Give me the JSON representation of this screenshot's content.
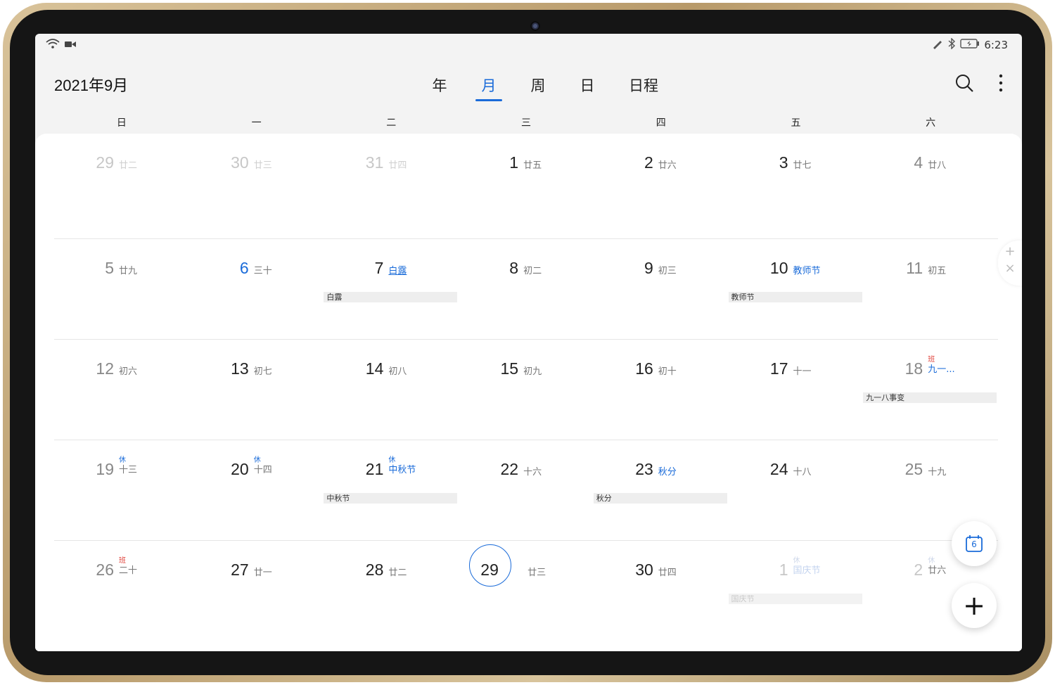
{
  "status": {
    "time": "6:23"
  },
  "header": {
    "title": "2021年9月",
    "tabs": [
      {
        "label": "年"
      },
      {
        "label": "月"
      },
      {
        "label": "周"
      },
      {
        "label": "日"
      },
      {
        "label": "日程"
      }
    ],
    "active_tab": "月"
  },
  "weekdays": [
    "日",
    "一",
    "二",
    "三",
    "四",
    "五",
    "六"
  ],
  "weeks": [
    [
      {
        "day": "29",
        "lunar": "廿二"
      },
      {
        "day": "30",
        "lunar": "廿三"
      },
      {
        "day": "31",
        "lunar": "廿四"
      },
      {
        "day": "1",
        "lunar": "廿五"
      },
      {
        "day": "2",
        "lunar": "廿六"
      },
      {
        "day": "3",
        "lunar": "廿七"
      },
      {
        "day": "4",
        "lunar": "廿八"
      }
    ],
    [
      {
        "day": "5",
        "lunar": "廿九"
      },
      {
        "day": "6",
        "lunar": "三十"
      },
      {
        "day": "7",
        "lunar": "白露",
        "event": "白露"
      },
      {
        "day": "8",
        "lunar": "初二"
      },
      {
        "day": "9",
        "lunar": "初三"
      },
      {
        "day": "10",
        "lunar": "教师节",
        "event": "教师节"
      },
      {
        "day": "11",
        "lunar": "初五"
      }
    ],
    [
      {
        "day": "12",
        "lunar": "初六"
      },
      {
        "day": "13",
        "lunar": "初七"
      },
      {
        "day": "14",
        "lunar": "初八"
      },
      {
        "day": "15",
        "lunar": "初九"
      },
      {
        "day": "16",
        "lunar": "初十"
      },
      {
        "day": "17",
        "lunar": "十一"
      },
      {
        "day": "18",
        "tag": "班",
        "lunar": "九一...",
        "event": "九一八事变"
      }
    ],
    [
      {
        "day": "19",
        "tag": "休",
        "lunar": "十三"
      },
      {
        "day": "20",
        "tag": "休",
        "lunar": "十四"
      },
      {
        "day": "21",
        "tag": "休",
        "lunar": "中秋节",
        "event": "中秋节"
      },
      {
        "day": "22",
        "lunar": "十六"
      },
      {
        "day": "23",
        "lunar": "秋分",
        "event": "秋分"
      },
      {
        "day": "24",
        "lunar": "十八"
      },
      {
        "day": "25",
        "lunar": "十九"
      }
    ],
    [
      {
        "day": "26",
        "tag": "班",
        "lunar": "二十"
      },
      {
        "day": "27",
        "lunar": "廿一"
      },
      {
        "day": "28",
        "lunar": "廿二"
      },
      {
        "day": "29",
        "lunar": "廿三"
      },
      {
        "day": "30",
        "lunar": "廿四"
      },
      {
        "day": "1",
        "tag": "休",
        "lunar": "国庆节",
        "event": "国庆节"
      },
      {
        "day": "2",
        "tag": "休",
        "lunar": "廿六"
      }
    ]
  ],
  "fab": {
    "today_label": "6",
    "add_label": "+"
  },
  "side_tool": {
    "plus": "+",
    "close": "×"
  },
  "colors": {
    "accent": "#1a6bd9",
    "rest": "#1a6bd9",
    "work": "#e0433b"
  }
}
